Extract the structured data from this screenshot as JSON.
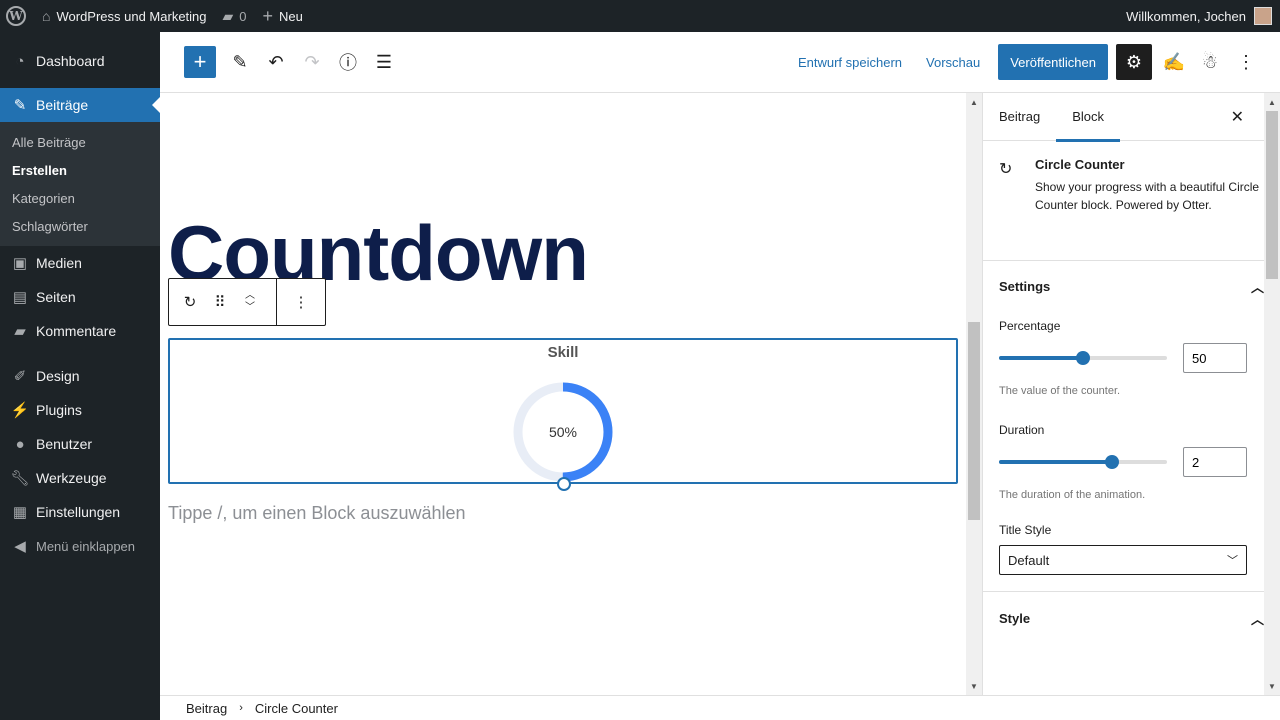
{
  "adminbar": {
    "site_name": "WordPress und Marketing",
    "comments_count": "0",
    "new_label": "Neu",
    "greeting": "Willkommen, Jochen"
  },
  "sidebar": {
    "items": [
      {
        "label": "Dashboard",
        "icon": "dashboard-icon"
      },
      {
        "label": "Beiträge",
        "icon": "pin-icon"
      },
      {
        "label": "Medien",
        "icon": "media-icon"
      },
      {
        "label": "Seiten",
        "icon": "pages-icon"
      },
      {
        "label": "Kommentare",
        "icon": "comment-icon"
      },
      {
        "label": "Design",
        "icon": "brush-icon"
      },
      {
        "label": "Plugins",
        "icon": "plugin-icon"
      },
      {
        "label": "Benutzer",
        "icon": "user-icon"
      },
      {
        "label": "Werkzeuge",
        "icon": "wrench-icon"
      },
      {
        "label": "Einstellungen",
        "icon": "settings-icon"
      }
    ],
    "submenu": [
      "Alle Beiträge",
      "Erstellen",
      "Kategorien",
      "Schlagwörter"
    ],
    "collapse_label": "Menü einklappen"
  },
  "header": {
    "save_draft": "Entwurf speichern",
    "preview": "Vorschau",
    "publish": "Veröffentlichen"
  },
  "canvas": {
    "post_title": "Countdown",
    "counter_title": "Skill",
    "counter_value": "50%",
    "counter_fraction": 0.5,
    "placeholder": "Tippe /, um einen Block auszuwählen",
    "counter_color": "#3b82f6"
  },
  "inspector": {
    "tabs": [
      "Beitrag",
      "Block"
    ],
    "block_name": "Circle Counter",
    "block_desc": "Show your progress with a beautiful Circle Counter block. Powered by Otter.",
    "settings_title": "Settings",
    "percentage_label": "Percentage",
    "percentage_value": "50",
    "percentage_fraction": 0.5,
    "percentage_help": "The value of the counter.",
    "duration_label": "Duration",
    "duration_value": "2",
    "duration_fraction": 0.67,
    "duration_help": "The duration of the animation.",
    "title_style_label": "Title Style",
    "title_style_value": "Default",
    "style_title": "Style"
  },
  "footer": {
    "crumbs": [
      "Beitrag",
      "Circle Counter"
    ]
  },
  "colors": {
    "accent": "#2271b1",
    "admin_dark": "#1d2327",
    "title_color": "#0e1e4a"
  }
}
